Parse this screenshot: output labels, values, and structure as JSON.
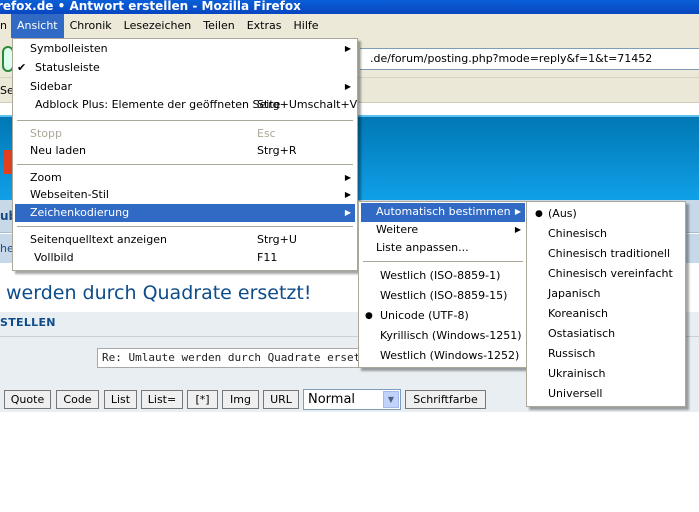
{
  "window": {
    "title": "firefox.de • Antwort erstellen - Mozilla Firefox"
  },
  "menubar": [
    "n",
    "Ansicht",
    "Chronik",
    "Lesezeichen",
    "Teilen",
    "Extras",
    "Hilfe"
  ],
  "toolbar": {
    "url": ".de/forum/posting.php?mode=reply&f=1&t=71452",
    "bookmark_fragment": "Sei"
  },
  "page": {
    "row1_fragment": "ub",
    "row2_fragment": "he",
    "heading": "werden durch Quadrate ersetzt!",
    "section": "STELLEN",
    "subject": "Re: Umlaute werden durch Quadrate ersetzt",
    "buttons": [
      "Quote",
      "Code",
      "List",
      "List=",
      "[*]",
      "Img",
      "URL"
    ],
    "size_select": "Normal",
    "color_button": "Schriftfarbe"
  },
  "view_menu": {
    "items": [
      {
        "label": "Symbolleisten",
        "submenu": true
      },
      {
        "label": "Statusleiste",
        "checked": true
      },
      {
        "label": "Sidebar",
        "submenu": true
      },
      {
        "label": "Adblock Plus: Elemente der geöffneten Seite",
        "shortcut": "Strg+Umschalt+V"
      },
      {
        "label": "Stopp",
        "shortcut": "Esc",
        "disabled": true
      },
      {
        "label": "Neu laden",
        "shortcut": "Strg+R"
      },
      {
        "label": "Zoom",
        "submenu": true
      },
      {
        "label": "Webseiten-Stil",
        "submenu": true
      },
      {
        "label": "Zeichenkodierung",
        "submenu": true,
        "highlighted": true
      },
      {
        "label": "Seitenquelltext anzeigen",
        "shortcut": "Strg+U"
      },
      {
        "label": "Vollbild",
        "shortcut": "F11"
      }
    ]
  },
  "encoding_menu": {
    "items": [
      {
        "label": "Automatisch bestimmen",
        "submenu": true,
        "highlighted": true
      },
      {
        "label": "Weitere",
        "submenu": true
      },
      {
        "label": "Liste anpassen..."
      },
      {
        "label": "Westlich (ISO-8859-1)"
      },
      {
        "label": "Westlich (ISO-8859-15)"
      },
      {
        "label": "Unicode (UTF-8)",
        "selected": true
      },
      {
        "label": "Kyrillisch (Windows-1251)"
      },
      {
        "label": "Westlich (Windows-1252)"
      }
    ]
  },
  "auto_menu": {
    "items": [
      "(Aus)",
      "Chinesisch",
      "Chinesisch traditionell",
      "Chinesisch vereinfacht",
      "Japanisch",
      "Koreanisch",
      "Ostasiatisch",
      "Russisch",
      "Ukrainisch",
      "Universell"
    ],
    "selected": "(Aus)"
  },
  "glyphs": {
    "arrow": "▶",
    "check": "✔",
    "bullet": "●",
    "dropdown": "▼"
  }
}
